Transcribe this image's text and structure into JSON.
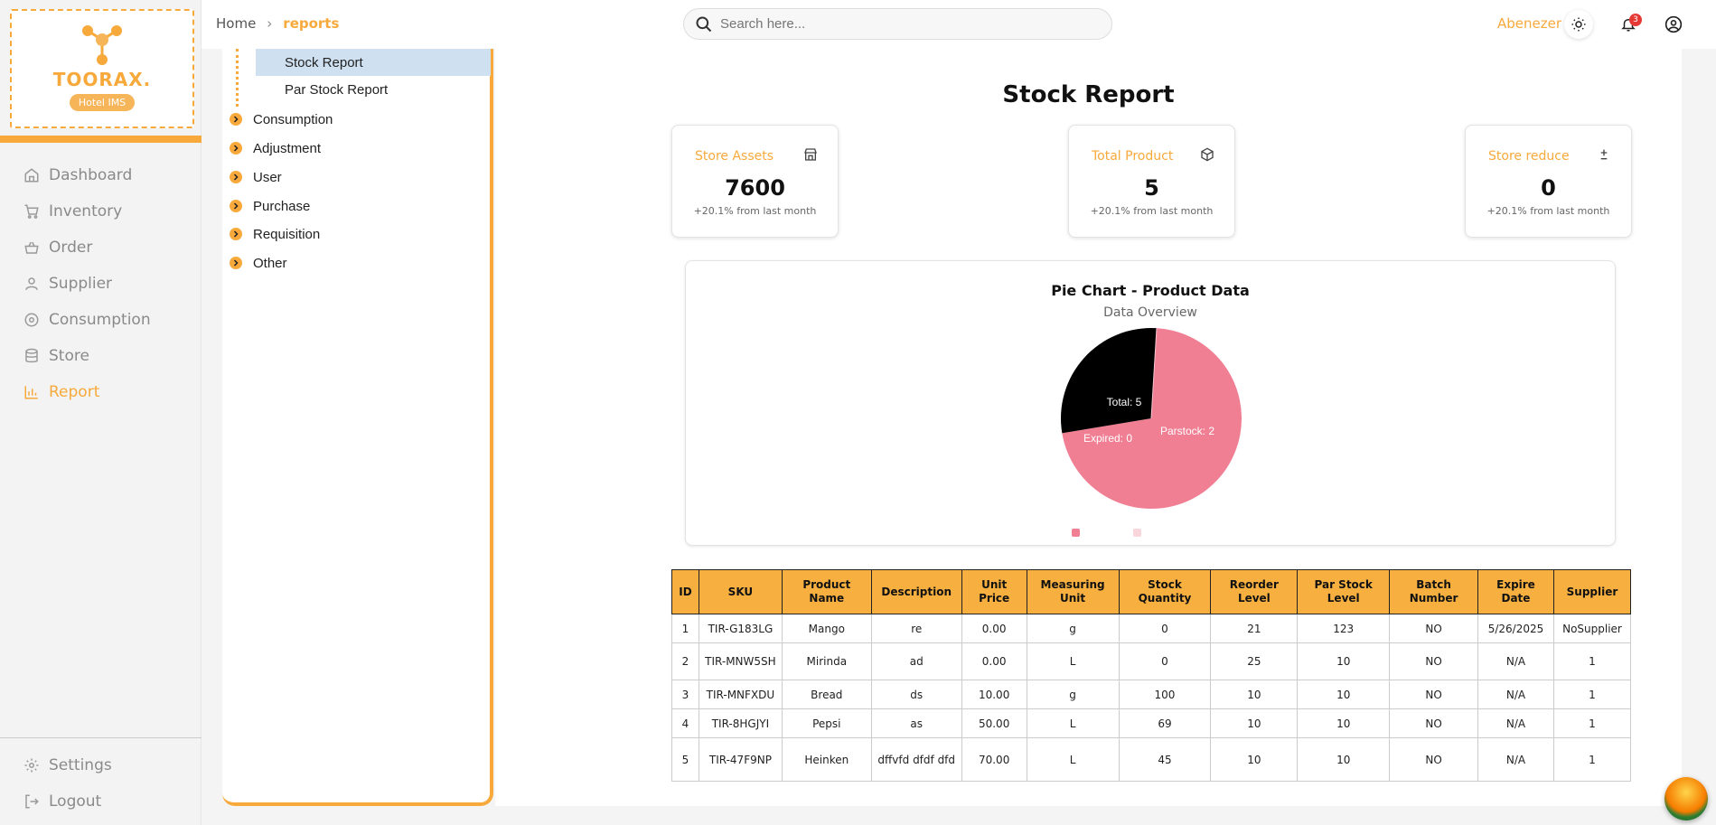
{
  "brand": {
    "name": "TOORAX.",
    "badge": "Hotel IMS",
    "accent": "#f7a93b"
  },
  "sidebar": {
    "items": [
      {
        "label": "Dashboard",
        "icon": "home-icon"
      },
      {
        "label": "Inventory",
        "icon": "cart-icon"
      },
      {
        "label": "Order",
        "icon": "basket-icon"
      },
      {
        "label": "Supplier",
        "icon": "user-icon"
      },
      {
        "label": "Consumption",
        "icon": "disc-icon"
      },
      {
        "label": "Store",
        "icon": "database-icon"
      },
      {
        "label": "Report",
        "icon": "bar-chart-icon",
        "active": true
      }
    ],
    "bottom": [
      {
        "label": "Settings",
        "icon": "gear-icon"
      },
      {
        "label": "Logout",
        "icon": "logout-icon"
      }
    ]
  },
  "header": {
    "breadcrumb": {
      "home": "Home",
      "current": "reports"
    },
    "search_placeholder": "Search here...",
    "user": "Abenezer",
    "notifications": "3"
  },
  "submenu": {
    "children": [
      {
        "label": "Stock Report",
        "selected": true
      },
      {
        "label": "Par Stock Report",
        "selected": false
      }
    ],
    "groups": [
      "Consumption",
      "Adjustment",
      "User",
      "Purchase",
      "Requisition",
      "Other"
    ]
  },
  "main": {
    "title": "Stock Report",
    "cards": [
      {
        "label": "Store Assets",
        "value": "7600",
        "sub": "+20.1% from last month",
        "icon": "store-icon"
      },
      {
        "label": "Total Product",
        "value": "5",
        "sub": "+20.1% from last month",
        "icon": "box-icon"
      },
      {
        "label": "Store reduce",
        "value": "0",
        "sub": "+20.1% from last month",
        "icon": "plus-minus-icon"
      }
    ],
    "table": {
      "headers": [
        "ID",
        "SKU",
        "Product Name",
        "Description",
        "Unit Price",
        "Measuring Unit",
        "Stock Quantity",
        "Reorder Level",
        "Par Stock Level",
        "Batch Number",
        "Expire Date",
        "Supplier"
      ],
      "rows": [
        [
          "1",
          "TIR-G183LG",
          "Mango",
          "re",
          "0.00",
          "g",
          "0",
          "21",
          "123",
          "NO",
          "5/26/2025",
          "NoSupplier"
        ],
        [
          "2",
          "TIR-MNW5SH",
          "Mirinda",
          "ad",
          "0.00",
          "L",
          "0",
          "25",
          "10",
          "NO",
          "N/A",
          "1"
        ],
        [
          "3",
          "TIR-MNFXDU",
          "Bread",
          "ds",
          "10.00",
          "g",
          "100",
          "10",
          "10",
          "NO",
          "N/A",
          "1"
        ],
        [
          "4",
          "TIR-8HGJYI",
          "Pepsi",
          "as",
          "50.00",
          "L",
          "69",
          "10",
          "10",
          "NO",
          "N/A",
          "1"
        ],
        [
          "5",
          "TIR-47F9NP",
          "Heinken",
          "dffvfd dfdf dfd",
          "70.00",
          "L",
          "45",
          "10",
          "10",
          "NO",
          "N/A",
          "1"
        ]
      ]
    }
  },
  "chart_data": {
    "type": "pie",
    "title": "Pie Chart - Product Data",
    "subtitle": "Data Overview",
    "slices": [
      {
        "label": "Total: 5",
        "value": 5,
        "color": "#f07f94"
      },
      {
        "label": "Parstock: 2",
        "value": 2,
        "color": "#000000"
      },
      {
        "label": "Expired: 0",
        "value": 0,
        "color": "#f5c6cf"
      }
    ],
    "legend": {
      "placement": "bottom",
      "colors": [
        "#f07f94",
        "#f9d5dc"
      ]
    }
  }
}
